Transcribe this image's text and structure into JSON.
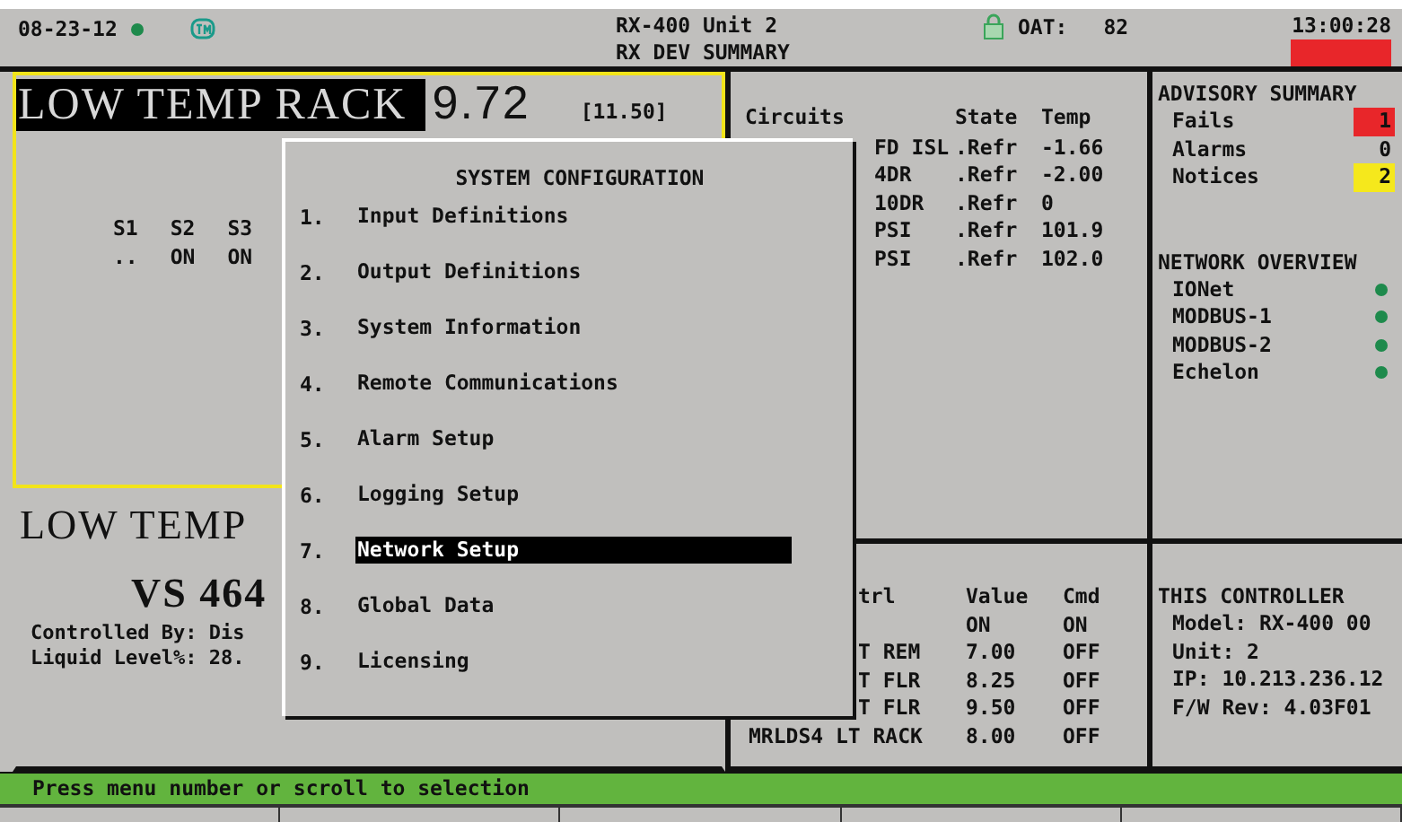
{
  "header": {
    "date": "08-23-12",
    "title": "RX-400 Unit 2",
    "subtitle": "RX DEV SUMMARY",
    "oat_label": "OAT:",
    "oat_value": "82",
    "time": "13:00:28",
    "alarm_active": true
  },
  "rack_panel": {
    "selected": true,
    "name": "LOW TEMP RACK",
    "value": "9.72",
    "setpoint": "[11.50]",
    "stages": [
      {
        "label": "S1",
        "state": ".."
      },
      {
        "label": "S2",
        "state": "ON"
      },
      {
        "label": "S3",
        "state": "ON"
      }
    ]
  },
  "compressor_panel": {
    "selected": false,
    "name": "LOW TEMP",
    "unit": "VS 464",
    "lines": [
      "Controlled By: Dis",
      "Liquid Level%: 28."
    ]
  },
  "circuits": {
    "columns": [
      "Circuits",
      "State",
      "Temp"
    ],
    "rows": [
      [
        "FD ISL",
        ".Refr",
        "-1.66"
      ],
      [
        "4DR",
        ".Refr",
        "-2.00"
      ],
      [
        "10DR",
        ".Refr",
        "0"
      ],
      [
        "PSI",
        ".Refr",
        "101.9"
      ],
      [
        "PSI",
        ".Refr",
        "102.0"
      ]
    ]
  },
  "control": {
    "columns": [
      "trl",
      "Value",
      "Cmd"
    ],
    "rows": [
      [
        "",
        "ON",
        "ON"
      ],
      [
        "T REM",
        "7.00",
        "OFF"
      ],
      [
        "T FLR",
        "8.25",
        "OFF"
      ],
      [
        "T FLR",
        "9.50",
        "OFF"
      ],
      [
        "MRLDS4 LT RACK",
        "8.00",
        "OFF"
      ]
    ]
  },
  "advisory_summary": {
    "title": "ADVISORY SUMMARY",
    "items": [
      {
        "label": "Fails",
        "count": "1",
        "color": "#e8262a"
      },
      {
        "label": "Alarms",
        "count": "0"
      },
      {
        "label": "Notices",
        "count": "2",
        "color": "#f5e81c"
      }
    ]
  },
  "network_overview": {
    "title": "NETWORK OVERVIEW",
    "items": [
      {
        "label": "IONet",
        "color": "#1e8a4c"
      },
      {
        "label": "MODBUS-1",
        "color": "#1e8a4c"
      },
      {
        "label": "MODBUS-2",
        "color": "#1e8a4c"
      },
      {
        "label": "Echelon",
        "color": "#1e8a4c"
      }
    ]
  },
  "this_controller": {
    "title": "THIS CONTROLLER",
    "lines": [
      "Model: RX-400   00",
      "Unit: 2",
      "IP: 10.213.236.12",
      "F/W Rev: 4.03F01"
    ]
  },
  "menu": {
    "title": "SYSTEM CONFIGURATION",
    "items": [
      {
        "number": "1.",
        "label": "Input Definitions",
        "selected": false
      },
      {
        "number": "2.",
        "label": "Output Definitions",
        "selected": false
      },
      {
        "number": "3.",
        "label": "System Information",
        "selected": false
      },
      {
        "number": "4.",
        "label": "Remote Communications",
        "selected": false
      },
      {
        "number": "5.",
        "label": "Alarm Setup",
        "selected": false
      },
      {
        "number": "6.",
        "label": "Logging Setup",
        "selected": false
      },
      {
        "number": "7.",
        "label": "Network Setup",
        "selected": true
      },
      {
        "number": "8.",
        "label": "Global Data",
        "selected": false
      },
      {
        "number": "9.",
        "label": "Licensing",
        "selected": false
      }
    ]
  },
  "status_bar": "Press menu number or scroll to selection"
}
